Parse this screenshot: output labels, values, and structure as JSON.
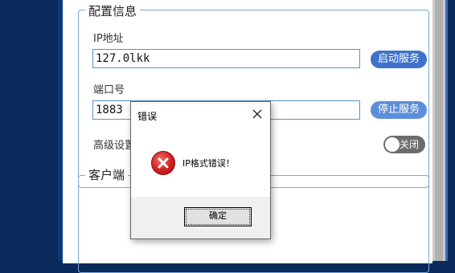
{
  "config_group": {
    "title": "配置信息",
    "ip_label": "IP地址",
    "ip_value": "127.0lkk",
    "start_button": "启动服务",
    "port_label": "端口号",
    "port_value": "1883",
    "stop_button": "停止服务",
    "advanced_label": "高级设置",
    "toggle_label": "关闭"
  },
  "client_group": {
    "title": "客户端"
  },
  "dialog": {
    "title": "错误",
    "message": "IP格式错误！",
    "ok_button": "确定",
    "close_icon": "close-icon",
    "error_icon": "error-icon"
  },
  "colors": {
    "background": "#0a2a5c",
    "accent": "#3f72c9",
    "error": "#d0201f"
  }
}
